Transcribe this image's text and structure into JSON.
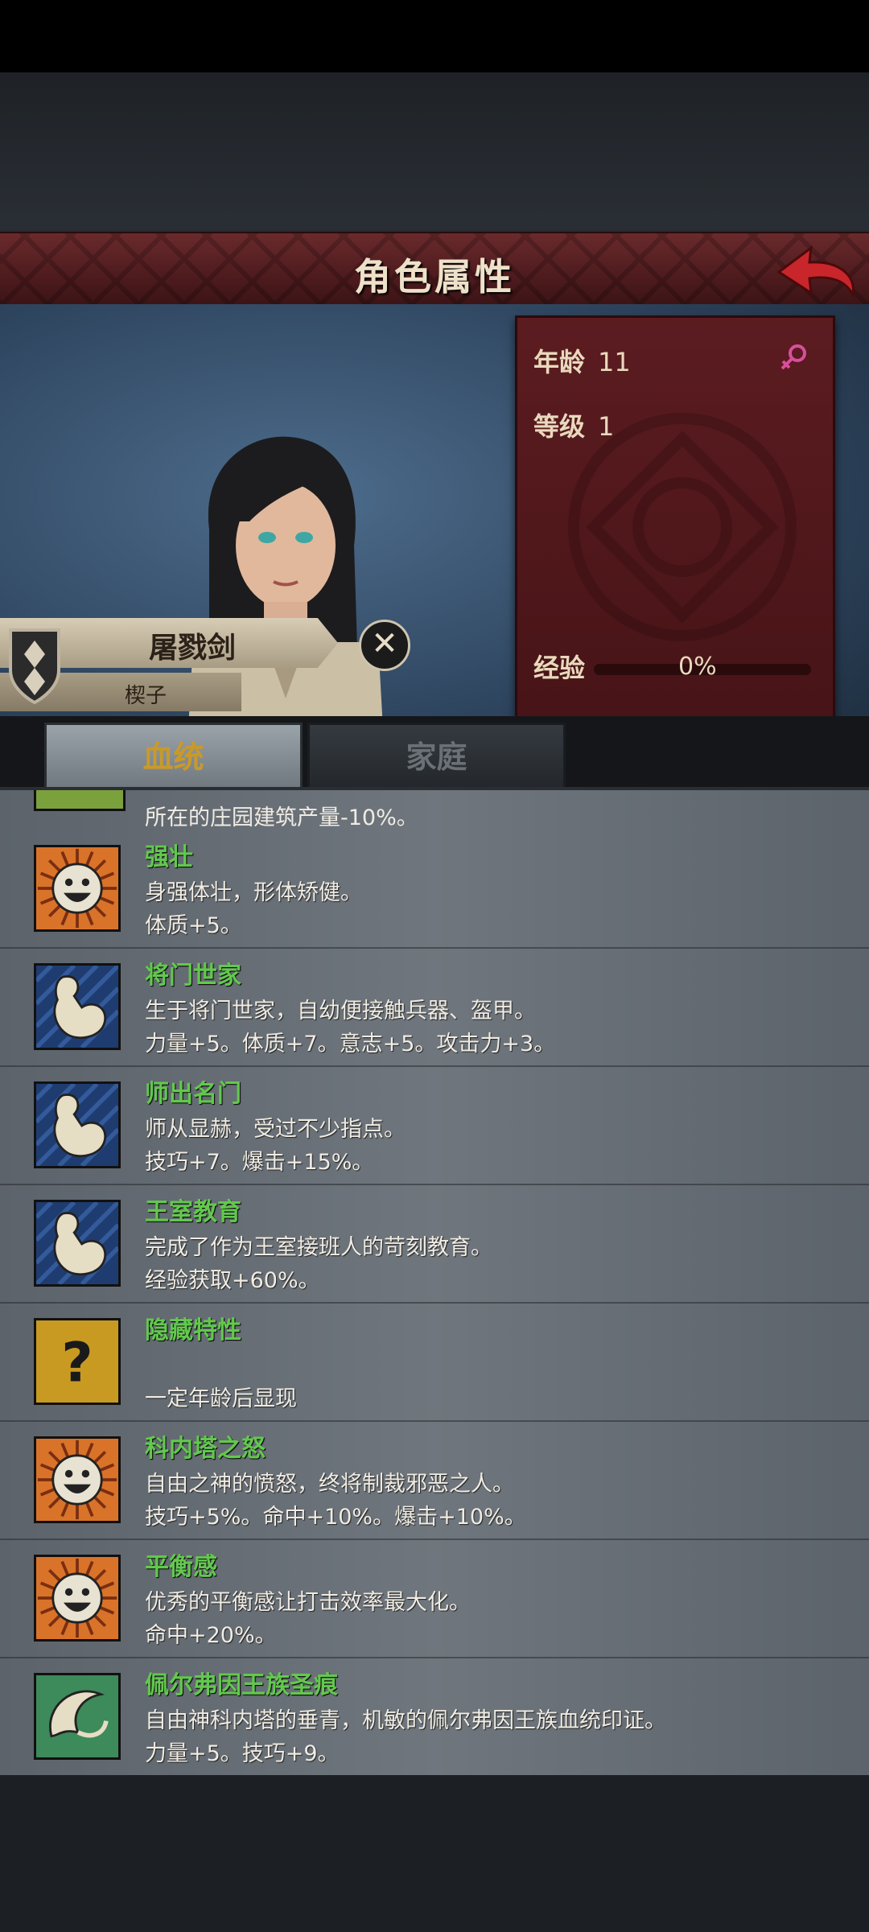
{
  "title": "角色属性",
  "info": {
    "age_label": "年龄",
    "age_value": "11",
    "level_label": "等级",
    "level_value": "1",
    "exp_label": "经验",
    "exp_value": "0%",
    "exp_fraction": 0.0
  },
  "character": {
    "name": "屠戮剑",
    "subname": "楔子"
  },
  "tabs": {
    "bloodline": "血统",
    "family": "家庭"
  },
  "partial_item": {
    "effect": "所在的庄园建筑产量-10%。"
  },
  "traits": [
    {
      "name": "强壮",
      "desc": "身强体壮，形体矫健。",
      "effect": "体质+5。",
      "icon": "smiley-icon"
    },
    {
      "name": "将门世家",
      "desc": "生于将门世家，自幼便接触兵器、盔甲。",
      "effect": "力量+5。体质+7。意志+5。攻击力+3。",
      "icon": "muscle-arm-icon"
    },
    {
      "name": "师出名门",
      "desc": "师从显赫，受过不少指点。",
      "effect": "技巧+7。爆击+15%。",
      "icon": "muscle-arm-icon"
    },
    {
      "name": "王室教育",
      "desc": "完成了作为王室接班人的苛刻教育。",
      "effect": "经验获取+60%。",
      "icon": "muscle-arm-icon"
    },
    {
      "name": "隐藏特性",
      "desc": "",
      "effect": "一定年龄后显现",
      "icon": "question-icon"
    },
    {
      "name": "科内塔之怒",
      "desc": "自由之神的愤怒，终将制裁邪恶之人。",
      "effect": "技巧+5%。命中+10%。爆击+10%。",
      "icon": "smiley-icon"
    },
    {
      "name": "平衡感",
      "desc": "优秀的平衡感让打击效率最大化。",
      "effect": "命中+20%。",
      "icon": "smiley-icon"
    },
    {
      "name": "佩尔弗因王族圣痕",
      "desc": "自由神科内塔的垂青，机敏的佩尔弗因王族血统印证。",
      "effect": "力量+5。技巧+9。",
      "icon": "feather-swirl-icon"
    }
  ],
  "colors": {
    "trait_name": "#63c84e",
    "title_bar": "#5a1f22",
    "panel": "#4d1619"
  }
}
